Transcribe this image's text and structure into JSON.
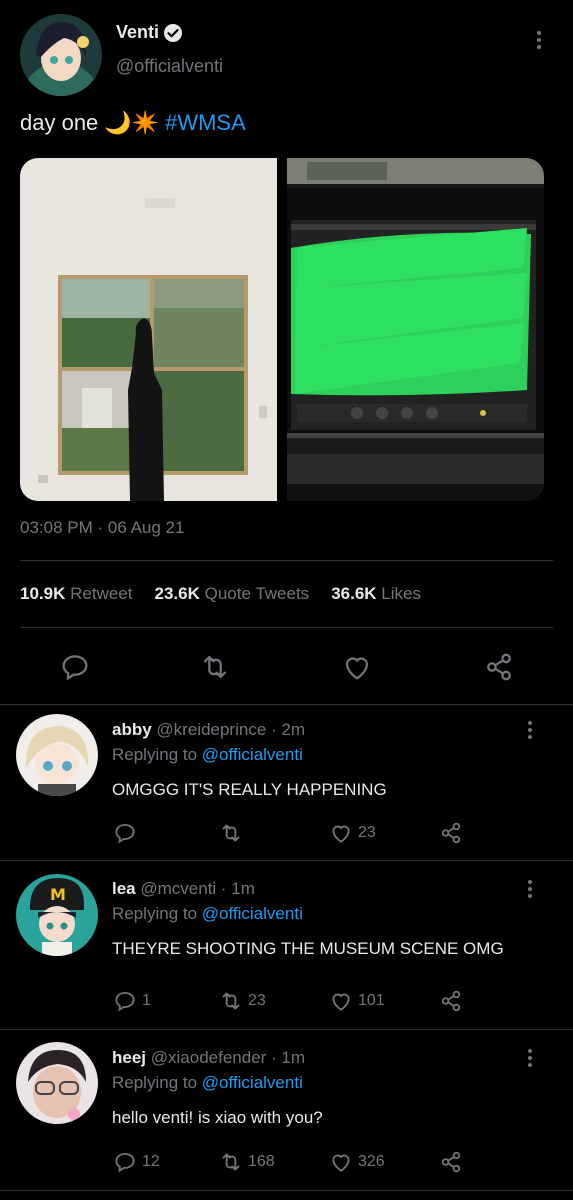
{
  "tweet": {
    "name": "Venti",
    "handle": "@officialventi",
    "text": "day one",
    "emoji": "🌙✴️",
    "hashtag": "#WMSA",
    "timestamp": "03:08 PM · 06 Aug 21",
    "stats": [
      {
        "count": "10.9K",
        "label": "Retweet"
      },
      {
        "count": "23.6K",
        "label": "Quote Tweets"
      },
      {
        "count": "36.6K",
        "label": "Likes"
      }
    ]
  },
  "replies": [
    {
      "name": "abby",
      "handle": "@kreideprince · 2m",
      "replying_prefix": "Replying to",
      "replying_to": "@officialventi",
      "text": "OMGGG IT'S REALLY HAPPENING",
      "reply_count": "",
      "retweet_count": "",
      "like_count": "23"
    },
    {
      "name": "lea",
      "handle": "@mcventi · 1m",
      "replying_prefix": "Replying to",
      "replying_to": "@officialventi",
      "text": "THEYRE SHOOTING THE MUSEUM SCENE OMG",
      "reply_count": "1",
      "retweet_count": "23",
      "like_count": "101"
    },
    {
      "name": "heej",
      "handle": "@xiaodefender · 1m",
      "replying_prefix": "Replying to",
      "replying_to": "@officialventi",
      "text": "hello venti! is xiao with you?",
      "reply_count": "12",
      "retweet_count": "168",
      "like_count": "326"
    }
  ],
  "colors": {
    "background": "#000000",
    "text": "#e7e9ea",
    "muted": "#71767b",
    "accent": "#1d9bf0",
    "divider": "#2f3336"
  },
  "icons": [
    "verified-icon",
    "more-icon",
    "reply-icon",
    "retweet-icon",
    "like-icon",
    "share-icon"
  ]
}
